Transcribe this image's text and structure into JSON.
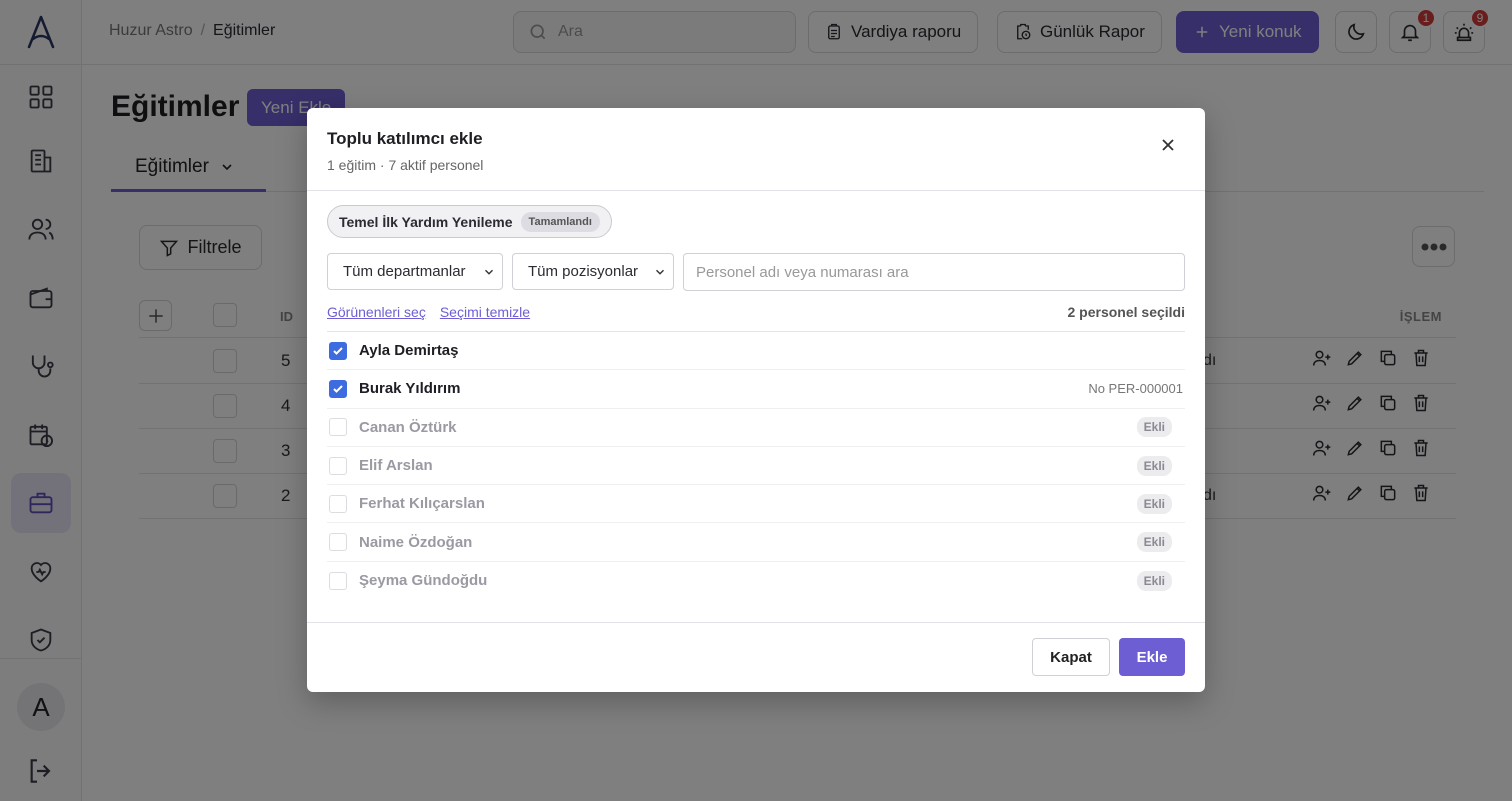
{
  "breadcrumb": {
    "root": "Huzur Astro",
    "separator": "/",
    "current": "Eğitimler"
  },
  "search": {
    "placeholder": "Ara"
  },
  "header": {
    "shift_report_label": "Vardiya raporu",
    "daily_report_label": "Günlük Rapor",
    "new_guest_label": "Yeni konuk",
    "notifications_count": "1",
    "alerts_count": "9"
  },
  "user": {
    "avatar_initial": "A"
  },
  "page": {
    "title": "Eğitimler",
    "new_button": "Yeni Ekle",
    "tab_label": "Eğitimler",
    "filter_label": "Filtrele",
    "col_id": "ID",
    "col_actions": "İŞLEM",
    "rows": [
      {
        "id": "5",
        "trail": "dı"
      },
      {
        "id": "4",
        "trail": ""
      },
      {
        "id": "3",
        "trail": ""
      },
      {
        "id": "2",
        "trail": "dı"
      }
    ]
  },
  "modal": {
    "title": "Toplu katılımcı ekle",
    "subtitle": "1 eğitim · 7 aktif personel",
    "training_chip": "Temel İlk Yardım Yenileme",
    "training_status": "Tamamlandı",
    "department_select": "Tüm departmanlar",
    "position_select": "Tüm pozisyonlar",
    "search_placeholder": "Personel adı veya numarası ara",
    "select_visible": "Görünenleri seç",
    "clear_selection": "Seçimi temizle",
    "selected_count": "2 personel seçildi",
    "people": [
      {
        "name": "Ayla Demirtaş",
        "checked": true,
        "disabled": false,
        "meta": ""
      },
      {
        "name": "Burak Yıldırım",
        "checked": true,
        "disabled": false,
        "meta": "No PER-000001"
      },
      {
        "name": "Canan Öztürk",
        "checked": false,
        "disabled": true,
        "tag": "Ekli"
      },
      {
        "name": "Elif Arslan",
        "checked": false,
        "disabled": true,
        "tag": "Ekli"
      },
      {
        "name": "Ferhat Kılıçarslan",
        "checked": false,
        "disabled": true,
        "tag": "Ekli"
      },
      {
        "name": "Naime Özdoğan",
        "checked": false,
        "disabled": true,
        "tag": "Ekli"
      },
      {
        "name": "Şeyma Gündoğdu",
        "checked": false,
        "disabled": true,
        "tag": "Ekli"
      }
    ],
    "close_button": "Kapat",
    "add_button": "Ekle"
  },
  "colors": {
    "accent": "#6d5fd3",
    "checkbox": "#3d6be0",
    "badge": "#d33a3a"
  },
  "icons": [
    "logo-icon",
    "grid-icon",
    "building-icon",
    "users-icon",
    "wallet-icon",
    "stethoscope-icon",
    "calendar-icon",
    "briefcase-icon",
    "heart-icon",
    "shield-icon",
    "logout-icon",
    "search-icon",
    "clipboard-icon",
    "clock-clipboard-icon",
    "plus-icon",
    "moon-icon",
    "bell-icon",
    "alarm-icon",
    "filter-icon",
    "more-icon",
    "user-plus-icon",
    "pencil-icon",
    "copy-icon",
    "trash-icon",
    "close-icon",
    "chevron-down-icon",
    "check-icon"
  ]
}
